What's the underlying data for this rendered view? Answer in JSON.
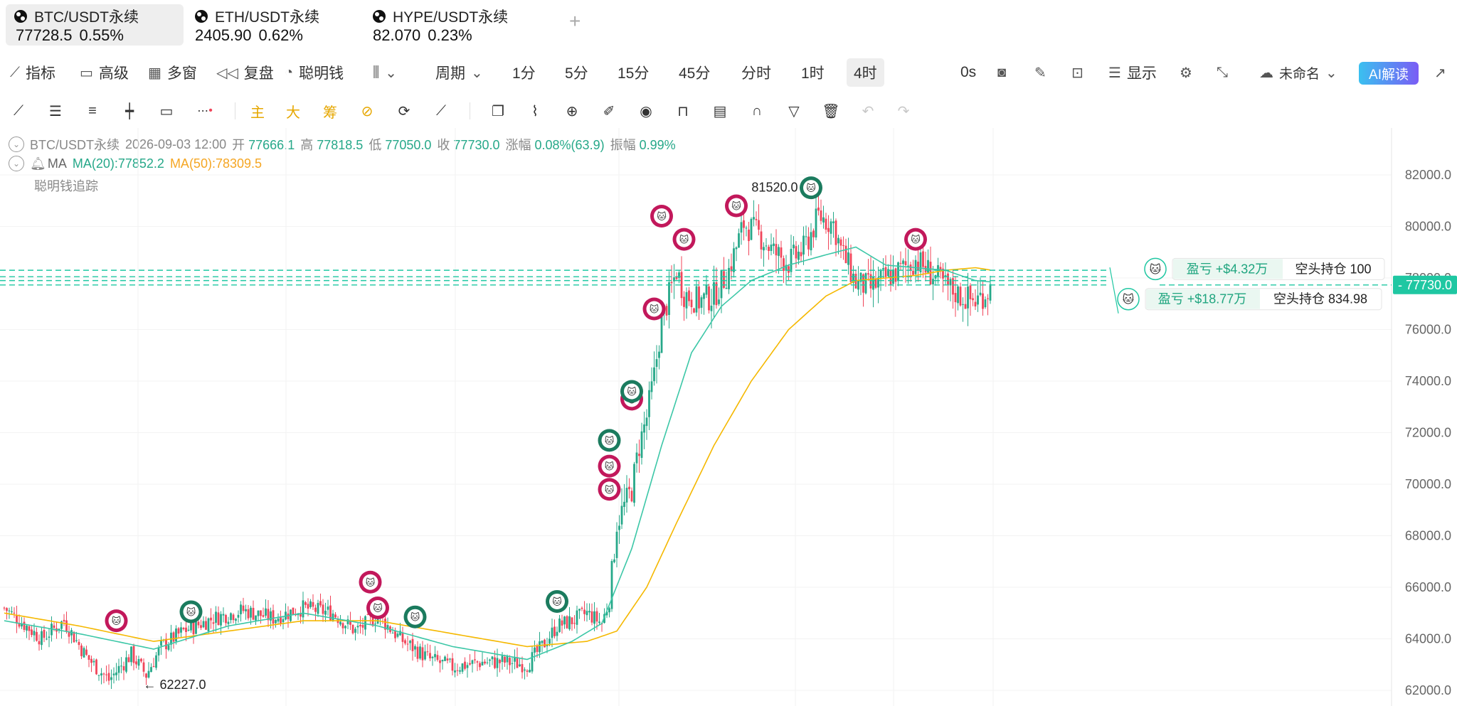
{
  "tabs": [
    {
      "name": "BTC/USDT永续",
      "price": "77728.5",
      "change": "0.55%"
    },
    {
      "name": "ETH/USDT永续",
      "price": "2405.90",
      "change": "0.62%"
    },
    {
      "name": "HYPE/USDT永续",
      "price": "82.070",
      "change": "0.23%"
    }
  ],
  "toolbar": {
    "indicators": "指标",
    "advanced": "高级",
    "multi_window": "多窗",
    "replay": "复盘",
    "smart_money": "聪明钱",
    "period": "周期",
    "intervals": [
      "1分",
      "5分",
      "15分",
      "45分",
      "分时",
      "1时",
      "4时"
    ],
    "active_interval": "4时",
    "countdown": "0s",
    "display": "显示",
    "layout_name": "未命名",
    "ai_label": "AI解读"
  },
  "drawing_tools": {
    "main": "主",
    "big": "大",
    "chips": "筹"
  },
  "info": {
    "symbol": "BTC/USDT永续",
    "datetime": "2026-09-03 12:00",
    "open_label": "开",
    "open": "77666.1",
    "high_label": "高",
    "high": "77818.5",
    "low_label": "低",
    "low": "77050.0",
    "close_label": "收",
    "close": "77730.0",
    "change_label": "涨幅",
    "change": "0.08%(63.9)",
    "amp_label": "振幅",
    "amp": "0.99%",
    "ma_label": "MA",
    "ma20": "MA(20):77852.2",
    "ma50": "MA(50):78309.5",
    "smart_money": "聪明钱追踪"
  },
  "positions": [
    {
      "pnl": "盈亏 +$4.32万",
      "side": "空头持仓 100"
    },
    {
      "pnl": "盈亏 +$18.77万",
      "side": "空头持仓 834.98"
    }
  ],
  "colors": {
    "up": "#26a889",
    "down": "#f0455a",
    "ma20": "#3cc7a7",
    "ma50": "#f5b800",
    "accent": "#1fc7a2"
  },
  "chart_data": {
    "type": "candlestick",
    "ylim": [
      61500,
      83000
    ],
    "y_ticks": [
      "82000.0",
      "80000.0",
      "78000.0",
      "76000.0",
      "74000.0",
      "72000.0",
      "70000.0",
      "68000.0",
      "66000.0",
      "64000.0",
      "62000.0"
    ],
    "last_price_label": "77730.0",
    "last_price": 77730,
    "annotations": [
      {
        "text": "81520.0",
        "value": 81520
      },
      {
        "text": "← 62227.0",
        "value": 62227
      }
    ],
    "close_path": [
      [
        0,
        65200
      ],
      [
        5,
        64000
      ],
      [
        8,
        64700
      ],
      [
        11,
        63300
      ],
      [
        14,
        62400
      ],
      [
        17,
        63400
      ],
      [
        19,
        62600
      ],
      [
        21,
        63700
      ],
      [
        24,
        64300
      ],
      [
        28,
        64800
      ],
      [
        32,
        65100
      ],
      [
        36,
        64800
      ],
      [
        40,
        65200
      ],
      [
        44,
        65000
      ],
      [
        47,
        64300
      ],
      [
        50,
        64900
      ],
      [
        53,
        64000
      ],
      [
        57,
        63200
      ],
      [
        60,
        62900
      ],
      [
        64,
        63100
      ],
      [
        67,
        63100
      ],
      [
        70,
        63000
      ],
      [
        72,
        63700
      ],
      [
        74,
        64500
      ],
      [
        76,
        64700
      ],
      [
        78,
        65000
      ],
      [
        80,
        64600
      ],
      [
        81,
        65500
      ],
      [
        82,
        68500
      ],
      [
        84,
        69800
      ],
      [
        85,
        71500
      ],
      [
        86,
        72600
      ],
      [
        87,
        74200
      ],
      [
        88,
        76300
      ],
      [
        89,
        77300
      ],
      [
        90,
        78300
      ],
      [
        91,
        77400
      ],
      [
        93,
        77100
      ],
      [
        95,
        77300
      ],
      [
        97,
        78300
      ],
      [
        99,
        80100
      ],
      [
        101,
        79700
      ],
      [
        103,
        79000
      ],
      [
        105,
        78600
      ],
      [
        107,
        79100
      ],
      [
        109,
        80400
      ],
      [
        111,
        80100
      ],
      [
        112,
        79100
      ],
      [
        114,
        77800
      ],
      [
        116,
        77600
      ],
      [
        118,
        78000
      ],
      [
        120,
        78300
      ],
      [
        122,
        78700
      ],
      [
        124,
        78200
      ],
      [
        126,
        77700
      ],
      [
        128,
        77300
      ],
      [
        130,
        77100
      ],
      [
        132,
        77600
      ]
    ],
    "ma20_path": [
      [
        0,
        64700
      ],
      [
        10,
        64200
      ],
      [
        20,
        63600
      ],
      [
        30,
        64500
      ],
      [
        40,
        65000
      ],
      [
        50,
        64500
      ],
      [
        60,
        63700
      ],
      [
        70,
        63200
      ],
      [
        76,
        63900
      ],
      [
        80,
        64600
      ],
      [
        84,
        67500
      ],
      [
        88,
        71500
      ],
      [
        92,
        75100
      ],
      [
        96,
        76900
      ],
      [
        100,
        77900
      ],
      [
        105,
        78500
      ],
      [
        110,
        78900
      ],
      [
        114,
        79200
      ],
      [
        118,
        78500
      ],
      [
        122,
        78400
      ],
      [
        126,
        78300
      ],
      [
        130,
        77900
      ],
      [
        132,
        77850
      ]
    ],
    "ma50_path": [
      [
        0,
        65000
      ],
      [
        10,
        64500
      ],
      [
        20,
        63900
      ],
      [
        30,
        64300
      ],
      [
        40,
        64700
      ],
      [
        50,
        64700
      ],
      [
        60,
        64200
      ],
      [
        70,
        63700
      ],
      [
        78,
        63900
      ],
      [
        82,
        64300
      ],
      [
        86,
        66000
      ],
      [
        90,
        68500
      ],
      [
        95,
        71500
      ],
      [
        100,
        74000
      ],
      [
        105,
        76000
      ],
      [
        110,
        77300
      ],
      [
        114,
        77900
      ],
      [
        118,
        78000
      ],
      [
        122,
        78100
      ],
      [
        126,
        78300
      ],
      [
        130,
        78400
      ],
      [
        132,
        78310
      ]
    ],
    "markers": [
      {
        "i": 15,
        "v": 64700,
        "color": "red"
      },
      {
        "i": 25,
        "v": 65050,
        "color": "green"
      },
      {
        "i": 49,
        "v": 66200,
        "color": "red"
      },
      {
        "i": 50,
        "v": 65200,
        "color": "red"
      },
      {
        "i": 55,
        "v": 64850,
        "color": "green"
      },
      {
        "i": 74,
        "v": 65450,
        "color": "green"
      },
      {
        "i": 81,
        "v": 69800,
        "color": "red"
      },
      {
        "i": 81,
        "v": 70700,
        "color": "red"
      },
      {
        "i": 81,
        "v": 71700,
        "color": "green"
      },
      {
        "i": 84,
        "v": 73300,
        "color": "red"
      },
      {
        "i": 84,
        "v": 73600,
        "color": "green"
      },
      {
        "i": 87,
        "v": 76800,
        "color": "red"
      },
      {
        "i": 88,
        "v": 80400,
        "color": "red"
      },
      {
        "i": 91,
        "v": 79500,
        "color": "red"
      },
      {
        "i": 98,
        "v": 80800,
        "color": "red"
      },
      {
        "i": 108,
        "v": 81500,
        "color": "green"
      },
      {
        "i": 122,
        "v": 79500,
        "color": "red"
      }
    ]
  }
}
